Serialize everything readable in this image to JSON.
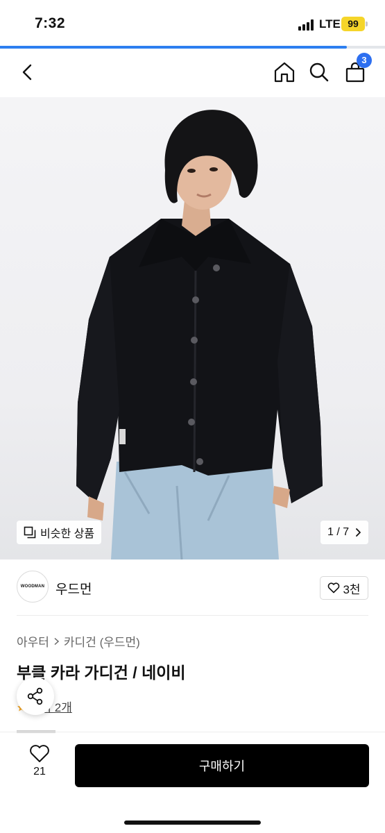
{
  "status_bar": {
    "time": "7:32",
    "network": "LTE",
    "battery": "99",
    "battery_color": "#f5d52a"
  },
  "page_load_progress": 0.9,
  "header": {
    "back_icon": "chevron-left-icon",
    "home_icon": "home-icon",
    "search_icon": "search-icon",
    "cart_icon": "shopping-bag-icon",
    "cart_count": "3",
    "badge_color": "#2d6ff0"
  },
  "gallery": {
    "similar_label": "비슷한 상품",
    "counter": "1 / 7"
  },
  "brand": {
    "logo_text": "WOODMAN",
    "name": "우드먼",
    "likes": "3천"
  },
  "product": {
    "category_parent": "아우터",
    "category_child": "카디건 (우드먼)",
    "title": "부클 카라 가디건 / 네이비",
    "review_link": "후기 2개"
  },
  "bottom_bar": {
    "wish_count": "21",
    "buy_label": "구매하기"
  }
}
